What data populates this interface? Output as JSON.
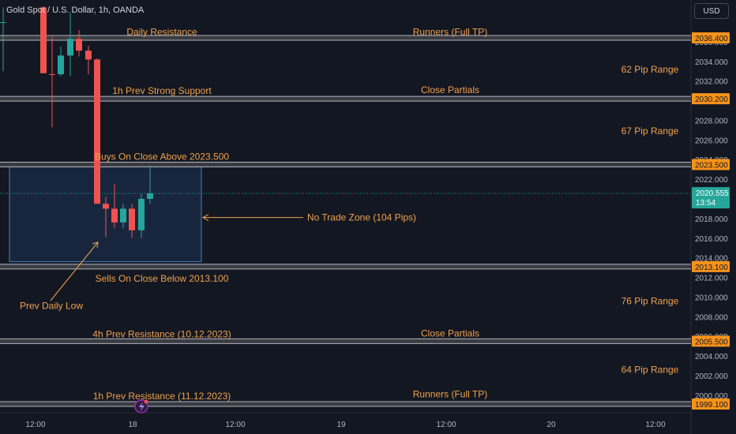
{
  "header": {
    "title": "Gold Spot / U.S. Dollar, 1h, OANDA",
    "currency": "USD"
  },
  "price_axis": {
    "ticks": [
      "2036.000",
      "2034.000",
      "2032.000",
      "2030.000",
      "2028.000",
      "2026.000",
      "2024.000",
      "2022.000",
      "2020.000",
      "2018.000",
      "2016.000",
      "2014.000",
      "2012.000",
      "2010.000",
      "2008.000",
      "2006.000",
      "2004.000",
      "2002.000",
      "2000.000"
    ],
    "current_price": "2020.555",
    "countdown": "13:54"
  },
  "time_axis": {
    "labels": [
      "12:00",
      "18",
      "12:00",
      "19",
      "12:00",
      "20",
      "12:00"
    ]
  },
  "levels": [
    {
      "price": 2036.4,
      "label": "2036.400"
    },
    {
      "price": 2030.2,
      "label": "2030.200"
    },
    {
      "price": 2023.5,
      "label": "2023.500"
    },
    {
      "price": 2013.1,
      "label": "2013.100"
    },
    {
      "price": 2005.5,
      "label": "2005.500"
    },
    {
      "price": 1999.1,
      "label": "1999.100"
    }
  ],
  "annotations": [
    {
      "text": "Daily Resistance",
      "price": 2037.0,
      "col": "mid"
    },
    {
      "text": "Runners (Full TP)",
      "price": 2037.0,
      "col": "right"
    },
    {
      "text": "62 Pip Range",
      "price": 2033.2,
      "col": "far"
    },
    {
      "text": "1h Prev Strong Support",
      "price": 2031.0,
      "col": "mid"
    },
    {
      "text": "Close Partials",
      "price": 2031.1,
      "col": "right"
    },
    {
      "text": "67 Pip Range",
      "price": 2026.9,
      "col": "far"
    },
    {
      "text": "Buys On Close Above 2023.500",
      "price": 2024.3,
      "col": "mid"
    },
    {
      "text": "No Trade Zone (104 Pips)",
      "price": 2018.1,
      "col": "zone"
    },
    {
      "text": "Sells On Close Below 2013.100",
      "price": 2011.9,
      "col": "mid"
    },
    {
      "text": "Prev Daily Low",
      "price": 2009.1,
      "col": "left"
    },
    {
      "text": "76 Pip Range",
      "price": 2009.6,
      "col": "far"
    },
    {
      "text": "4h Prev Resistance (10.12.2023)",
      "price": 2006.2,
      "col": "mid"
    },
    {
      "text": "Close Partials",
      "price": 2006.3,
      "col": "right"
    },
    {
      "text": "64 Pip Range",
      "price": 2002.6,
      "col": "far"
    },
    {
      "text": "1h Prev Resistance (11.12.2023)",
      "price": 1999.9,
      "col": "mid"
    },
    {
      "text": "Runners (Full TP)",
      "price": 2000.1,
      "col": "right"
    }
  ],
  "no_trade_zone": {
    "top": 2023.3,
    "bottom": 2013.6
  },
  "chart_data": {
    "type": "candlestick",
    "symbol": "Gold Spot / U.S. Dollar",
    "interval": "1h",
    "ylim": [
      1998.6,
      2039.6
    ],
    "candles": [
      {
        "o": 2038.0,
        "h": 2039.5,
        "l": 2033.0,
        "c": 2038.0,
        "dir": "up"
      },
      {
        "o": 2039.5,
        "h": 2039.6,
        "l": 2032.8,
        "c": 2032.8,
        "dir": "down"
      },
      {
        "o": 2032.7,
        "h": 2036.5,
        "l": 2027.3,
        "c": 2032.7,
        "dir": "down"
      },
      {
        "o": 2032.7,
        "h": 2035.5,
        "l": 2032.5,
        "c": 2034.6,
        "dir": "up"
      },
      {
        "o": 2034.6,
        "h": 2039.0,
        "l": 2032.5,
        "c": 2036.3,
        "dir": "up"
      },
      {
        "o": 2036.3,
        "h": 2037.2,
        "l": 2034.5,
        "c": 2035.1,
        "dir": "down"
      },
      {
        "o": 2035.1,
        "h": 2035.6,
        "l": 2032.7,
        "c": 2034.2,
        "dir": "down"
      },
      {
        "o": 2034.2,
        "h": 2034.3,
        "l": 2019.5,
        "c": 2019.5,
        "dir": "down"
      },
      {
        "o": 2019.5,
        "h": 2020.2,
        "l": 2016.1,
        "c": 2019.0,
        "dir": "down"
      },
      {
        "o": 2019.0,
        "h": 2021.5,
        "l": 2017.0,
        "c": 2017.6,
        "dir": "down"
      },
      {
        "o": 2017.6,
        "h": 2019.5,
        "l": 2017.0,
        "c": 2019.0,
        "dir": "up"
      },
      {
        "o": 2019.0,
        "h": 2019.5,
        "l": 2016.0,
        "c": 2016.8,
        "dir": "down"
      },
      {
        "o": 2016.8,
        "h": 2020.5,
        "l": 2016.0,
        "c": 2020.0,
        "dir": "up"
      },
      {
        "o": 2020.0,
        "h": 2023.4,
        "l": 2019.5,
        "c": 2020.555,
        "dir": "up"
      }
    ]
  },
  "colors": {
    "background": "#131722",
    "up": "#26a69a",
    "down": "#ef5350",
    "annotation": "#f0a14b",
    "level_line": "#b2b5be",
    "zone_fill": "#1e3a5f",
    "zone_border": "#4a7dbf",
    "price_tag": "#f7931a",
    "current_tag": "#26a69a"
  }
}
